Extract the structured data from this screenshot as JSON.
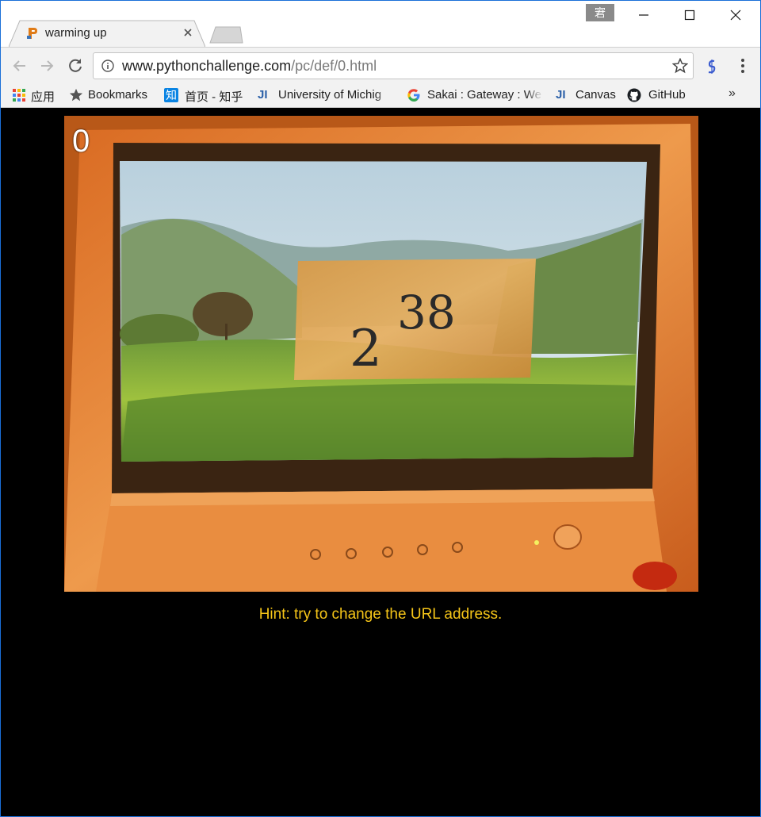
{
  "window": {
    "ime_indicator": "宭"
  },
  "tab": {
    "title": "warming up"
  },
  "address_bar": {
    "url_host": "www.pythonchallenge.com",
    "url_path": "/pc/def/0.html"
  },
  "bookmarks": [
    {
      "label": "应用",
      "icon": "apps-grid-icon"
    },
    {
      "label": "Bookmarks",
      "icon": "star-icon"
    },
    {
      "label": "首页 - 知乎",
      "icon": "zhihu-icon",
      "icon_text": "知"
    },
    {
      "label": "University of Michig",
      "icon": "ji-icon",
      "icon_text": "JI"
    },
    {
      "label": "Sakai : Gateway : We",
      "icon": "google-icon",
      "icon_text": "G"
    },
    {
      "label": "Canvas",
      "icon": "ji-icon",
      "icon_text": "JI"
    },
    {
      "label": "GitHub",
      "icon": "github-icon"
    }
  ],
  "page": {
    "level_number": "0",
    "image_exponent_base": "2",
    "image_exponent_power": "38",
    "hint": "Hint: try to change the URL address."
  },
  "colors": {
    "hint_text": "#f5c518",
    "page_background": "#000000",
    "monitor_bezel": "#e58a3c"
  }
}
